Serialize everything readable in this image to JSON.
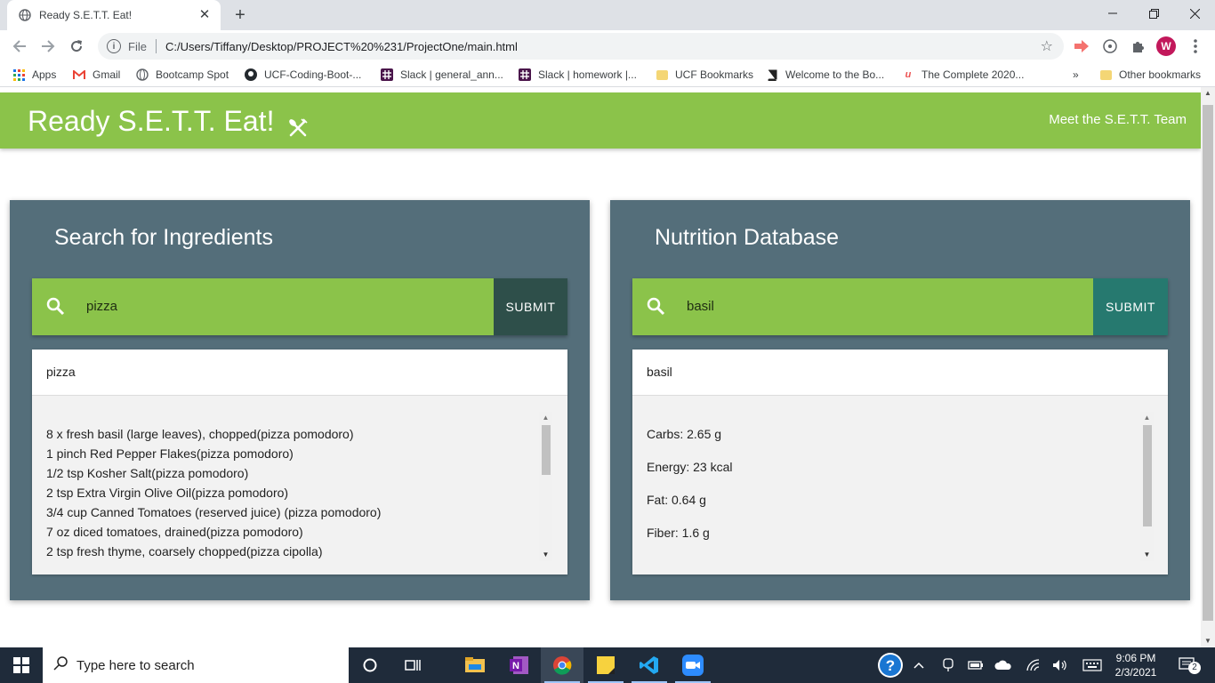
{
  "browser": {
    "tab_title": "Ready S.E.T.T. Eat!",
    "tab_close": "✕",
    "new_tab": "+",
    "file_label": "File",
    "url": "C:/Users/Tiffany/Desktop/PROJECT%20%231/ProjectOne/main.html",
    "profile_initial": "W"
  },
  "bookmarks": {
    "items": [
      {
        "label": "Apps",
        "icon": "apps-grid-icon"
      },
      {
        "label": "Gmail",
        "icon": "gmail-icon"
      },
      {
        "label": "Bootcamp Spot",
        "icon": "globe-icon"
      },
      {
        "label": "UCF-Coding-Boot-...",
        "icon": "github-icon"
      },
      {
        "label": "Slack | general_ann...",
        "icon": "slack-icon"
      },
      {
        "label": "Slack | homework |...",
        "icon": "slack-icon"
      },
      {
        "label": "UCF Bookmarks",
        "icon": "folder-icon"
      },
      {
        "label": "Welcome to the Bo...",
        "icon": "book-icon"
      },
      {
        "label": "The Complete 2020...",
        "icon": "udemy-icon"
      }
    ],
    "overflow": "»",
    "other": "Other bookmarks"
  },
  "navbar": {
    "brand": "Ready S.E.T.T. Eat!",
    "team_link": "Meet the S.E.T.T. Team"
  },
  "ingredients": {
    "title": "Search for Ingredients",
    "query": "pizza",
    "submit": "SUBMIT",
    "result_heading": "pizza",
    "results": [
      "8 x fresh basil (large leaves), chopped(pizza pomodoro)",
      "1 pinch Red Pepper Flakes(pizza pomodoro)",
      "1/2 tsp Kosher Salt(pizza pomodoro)",
      "2 tsp Extra Virgin Olive Oil(pizza pomodoro)",
      "3/4 cup Canned Tomatoes (reserved juice) (pizza pomodoro)",
      "7 oz diced tomatoes, drained(pizza pomodoro)",
      "2 tsp fresh thyme, coarsely chopped(pizza cipolla)"
    ]
  },
  "nutrition": {
    "title": "Nutrition Database",
    "query": "basil",
    "submit": "SUBMIT",
    "result_heading": "basil",
    "results": [
      "Carbs: 2.65 g",
      "Energy: 23 kcal",
      "Fat: 0.64 g",
      "Fiber: 1.6 g"
    ]
  },
  "taskbar": {
    "search_placeholder": "Type here to search",
    "time": "9:06 PM",
    "date": "2/3/2021",
    "notification_count": "2"
  },
  "colors": {
    "navbar": "#8bc34a",
    "card": "#546e7a",
    "submit_dark": "#2e4f4a",
    "submit_teal": "#26796f"
  }
}
